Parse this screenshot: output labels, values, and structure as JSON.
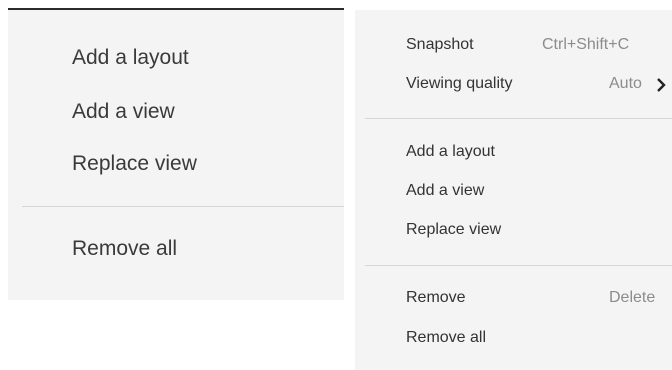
{
  "left_menu": {
    "items": [
      {
        "label": "Add a layout"
      },
      {
        "label": "Add a view"
      },
      {
        "label": "Replace view"
      },
      {
        "label": "Remove all"
      }
    ]
  },
  "right_menu": {
    "items": [
      {
        "label": "Snapshot",
        "shortcut": "Ctrl+Shift+C"
      },
      {
        "label": "Viewing quality",
        "value": "Auto",
        "submenu_icon": "chevron-right-icon"
      },
      {
        "label": "Add a layout"
      },
      {
        "label": "Add a view"
      },
      {
        "label": "Replace view"
      },
      {
        "label": "Remove",
        "shortcut": "Delete"
      },
      {
        "label": "Remove all"
      }
    ]
  },
  "colors": {
    "menu_background": "#f4f4f4",
    "text": "#333333",
    "shortcut_text": "#8c8c8c",
    "separator": "#d6d6d6"
  }
}
